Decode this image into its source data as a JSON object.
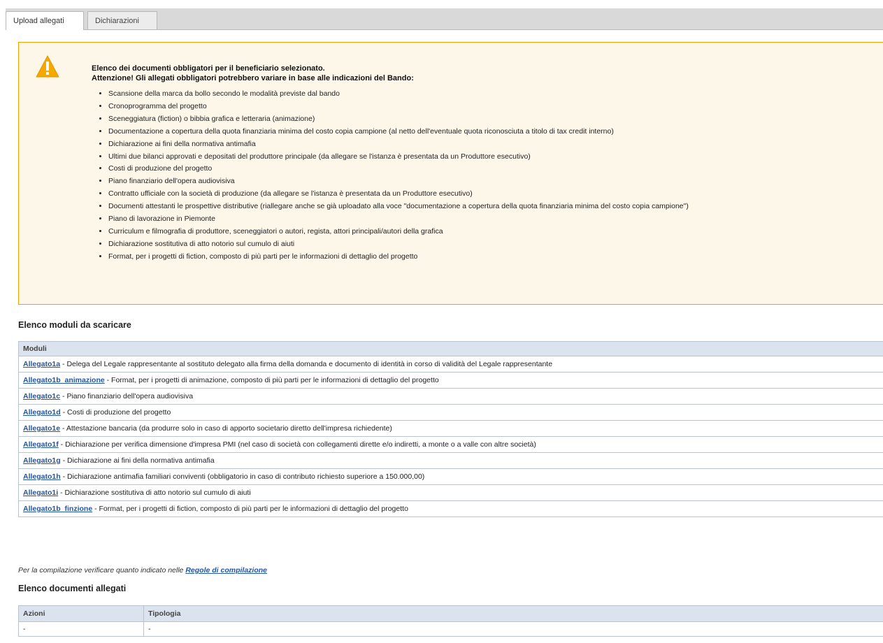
{
  "tabs": [
    {
      "label": "Upload allegati"
    },
    {
      "label": "Dichiarazioni"
    }
  ],
  "warning": {
    "line1": "Elenco dei documenti obbligatori per il beneficiario selezionato.",
    "line2": "Attenzione! Gli allegati obbligatori potrebbero variare in base alle indicazioni del Bando:",
    "items": [
      "Scansione della marca da bollo secondo le modalità previste dal bando",
      "Cronoprogramma del progetto",
      "Sceneggiatura (fiction) o bibbia grafica e letteraria (animazione)",
      "Documentazione a copertura della quota finanziaria minima del costo copia campione (al netto dell'eventuale quota riconosciuta a titolo di tax credit interno)",
      "Dichiarazione ai fini della normativa antimafia",
      "Ultimi due bilanci approvati e depositati del produttore principale (da allegare se l'istanza è presentata da un Produttore esecutivo)",
      "Costi di produzione del progetto",
      "Piano finanziario dell'opera audiovisiva",
      "Contratto ufficiale con la società di produzione (da allegare se l'istanza è presentata da un Produttore esecutivo)",
      "Documenti attestanti le prospettive distributive (riallegare anche se già uploadato alla voce \"documentazione a copertura della quota finanziaria minima del costo copia campione\")",
      "Piano di lavorazione in Piemonte",
      "Curriculum e filmografia di produttore, sceneggiatori o autori, regista, attori principali/autori della grafica",
      "Dichiarazione sostitutiva di atto notorio sul cumulo di aiuti",
      "Format, per i progetti di fiction, composto di più parti per le informazioni di dettaglio del progetto"
    ]
  },
  "moduli_section": {
    "title": "Elenco moduli da scaricare",
    "header": "Moduli",
    "rows": [
      {
        "link": "Allegato1a",
        "desc": " - Delega del Legale rappresentante al sostituto delegato alla firma della domanda e documento di identità in corso di validità del Legale rappresentante"
      },
      {
        "link": "Allegato1b_animazione",
        "desc": " - Format, per i progetti di animazione, composto di più parti per le informazioni di dettaglio del progetto"
      },
      {
        "link": "Allegato1c",
        "desc": " - Piano finanziario dell'opera audiovisiva"
      },
      {
        "link": "Allegato1d",
        "desc": " - Costi di produzione del progetto"
      },
      {
        "link": "Allegato1e",
        "desc": " - Attestazione bancaria (da produrre solo in caso di apporto societario diretto dell'impresa richiedente)"
      },
      {
        "link": "Allegato1f",
        "desc": " - Dichiarazione per verifica dimensione d'impresa PMI (nel caso di società con collegamenti dirette e/o indiretti, a monte o a valle con altre società)"
      },
      {
        "link": "Allegato1g",
        "desc": " - Dichiarazione ai fini della normativa antimafia"
      },
      {
        "link": "Allegato1h",
        "desc": " - Dichiarazione antimafia familiari conviventi (obbligatorio in caso di contributo richiesto superiore a 150.000,00)"
      },
      {
        "link": "Allegato1i",
        "desc": " - Dichiarazione sostitutiva di atto notorio sul cumulo di aiuti"
      },
      {
        "link": "Allegato1b_finzione",
        "desc": " - Format, per i progetti di fiction, composto di più parti per le informazioni di dettaglio del progetto"
      }
    ]
  },
  "note": {
    "text": "Per la compilazione verificare quanto indicato nelle ",
    "link": "Regole di compilazione"
  },
  "allegati_section": {
    "title": "Elenco documenti allegati",
    "headers": [
      "Azioni",
      "Tipologia"
    ],
    "row": [
      "-",
      "-"
    ]
  },
  "colors": {
    "warning_border": "#f0a000",
    "warning_icon": "#f5a800",
    "link": "#2456a8",
    "table_header": "#dbe3ee"
  },
  "icons": {
    "warning": "warning-triangle-icon"
  }
}
